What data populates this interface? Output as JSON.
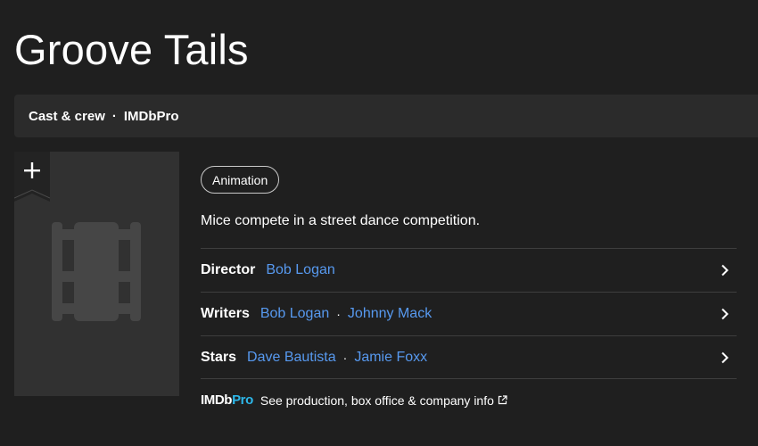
{
  "title": "Groove Tails",
  "subnav": {
    "cast_crew": "Cast & crew",
    "separator": "·",
    "imdbpro": "IMDbPro"
  },
  "poster": {
    "add_icon": "plus-icon",
    "placeholder_icon": "film-strip-icon"
  },
  "genre": "Animation",
  "plot": "Mice compete in a street dance competition.",
  "credits": {
    "director": {
      "label": "Director",
      "names": [
        "Bob Logan"
      ]
    },
    "writers": {
      "label": "Writers",
      "names": [
        "Bob Logan",
        "Johnny Mack"
      ]
    },
    "stars": {
      "label": "Stars",
      "names": [
        "Dave Bautista",
        "Jamie Foxx"
      ]
    },
    "separator": "·"
  },
  "imdbpro_promo": {
    "logo_imdb": "IMDb",
    "logo_pro": "Pro",
    "text": "See production, box office & company info",
    "icon": "external-link-icon"
  },
  "colors": {
    "background": "#1f1f1f",
    "link": "#5799ef",
    "pro_accent": "#2db7e9"
  }
}
